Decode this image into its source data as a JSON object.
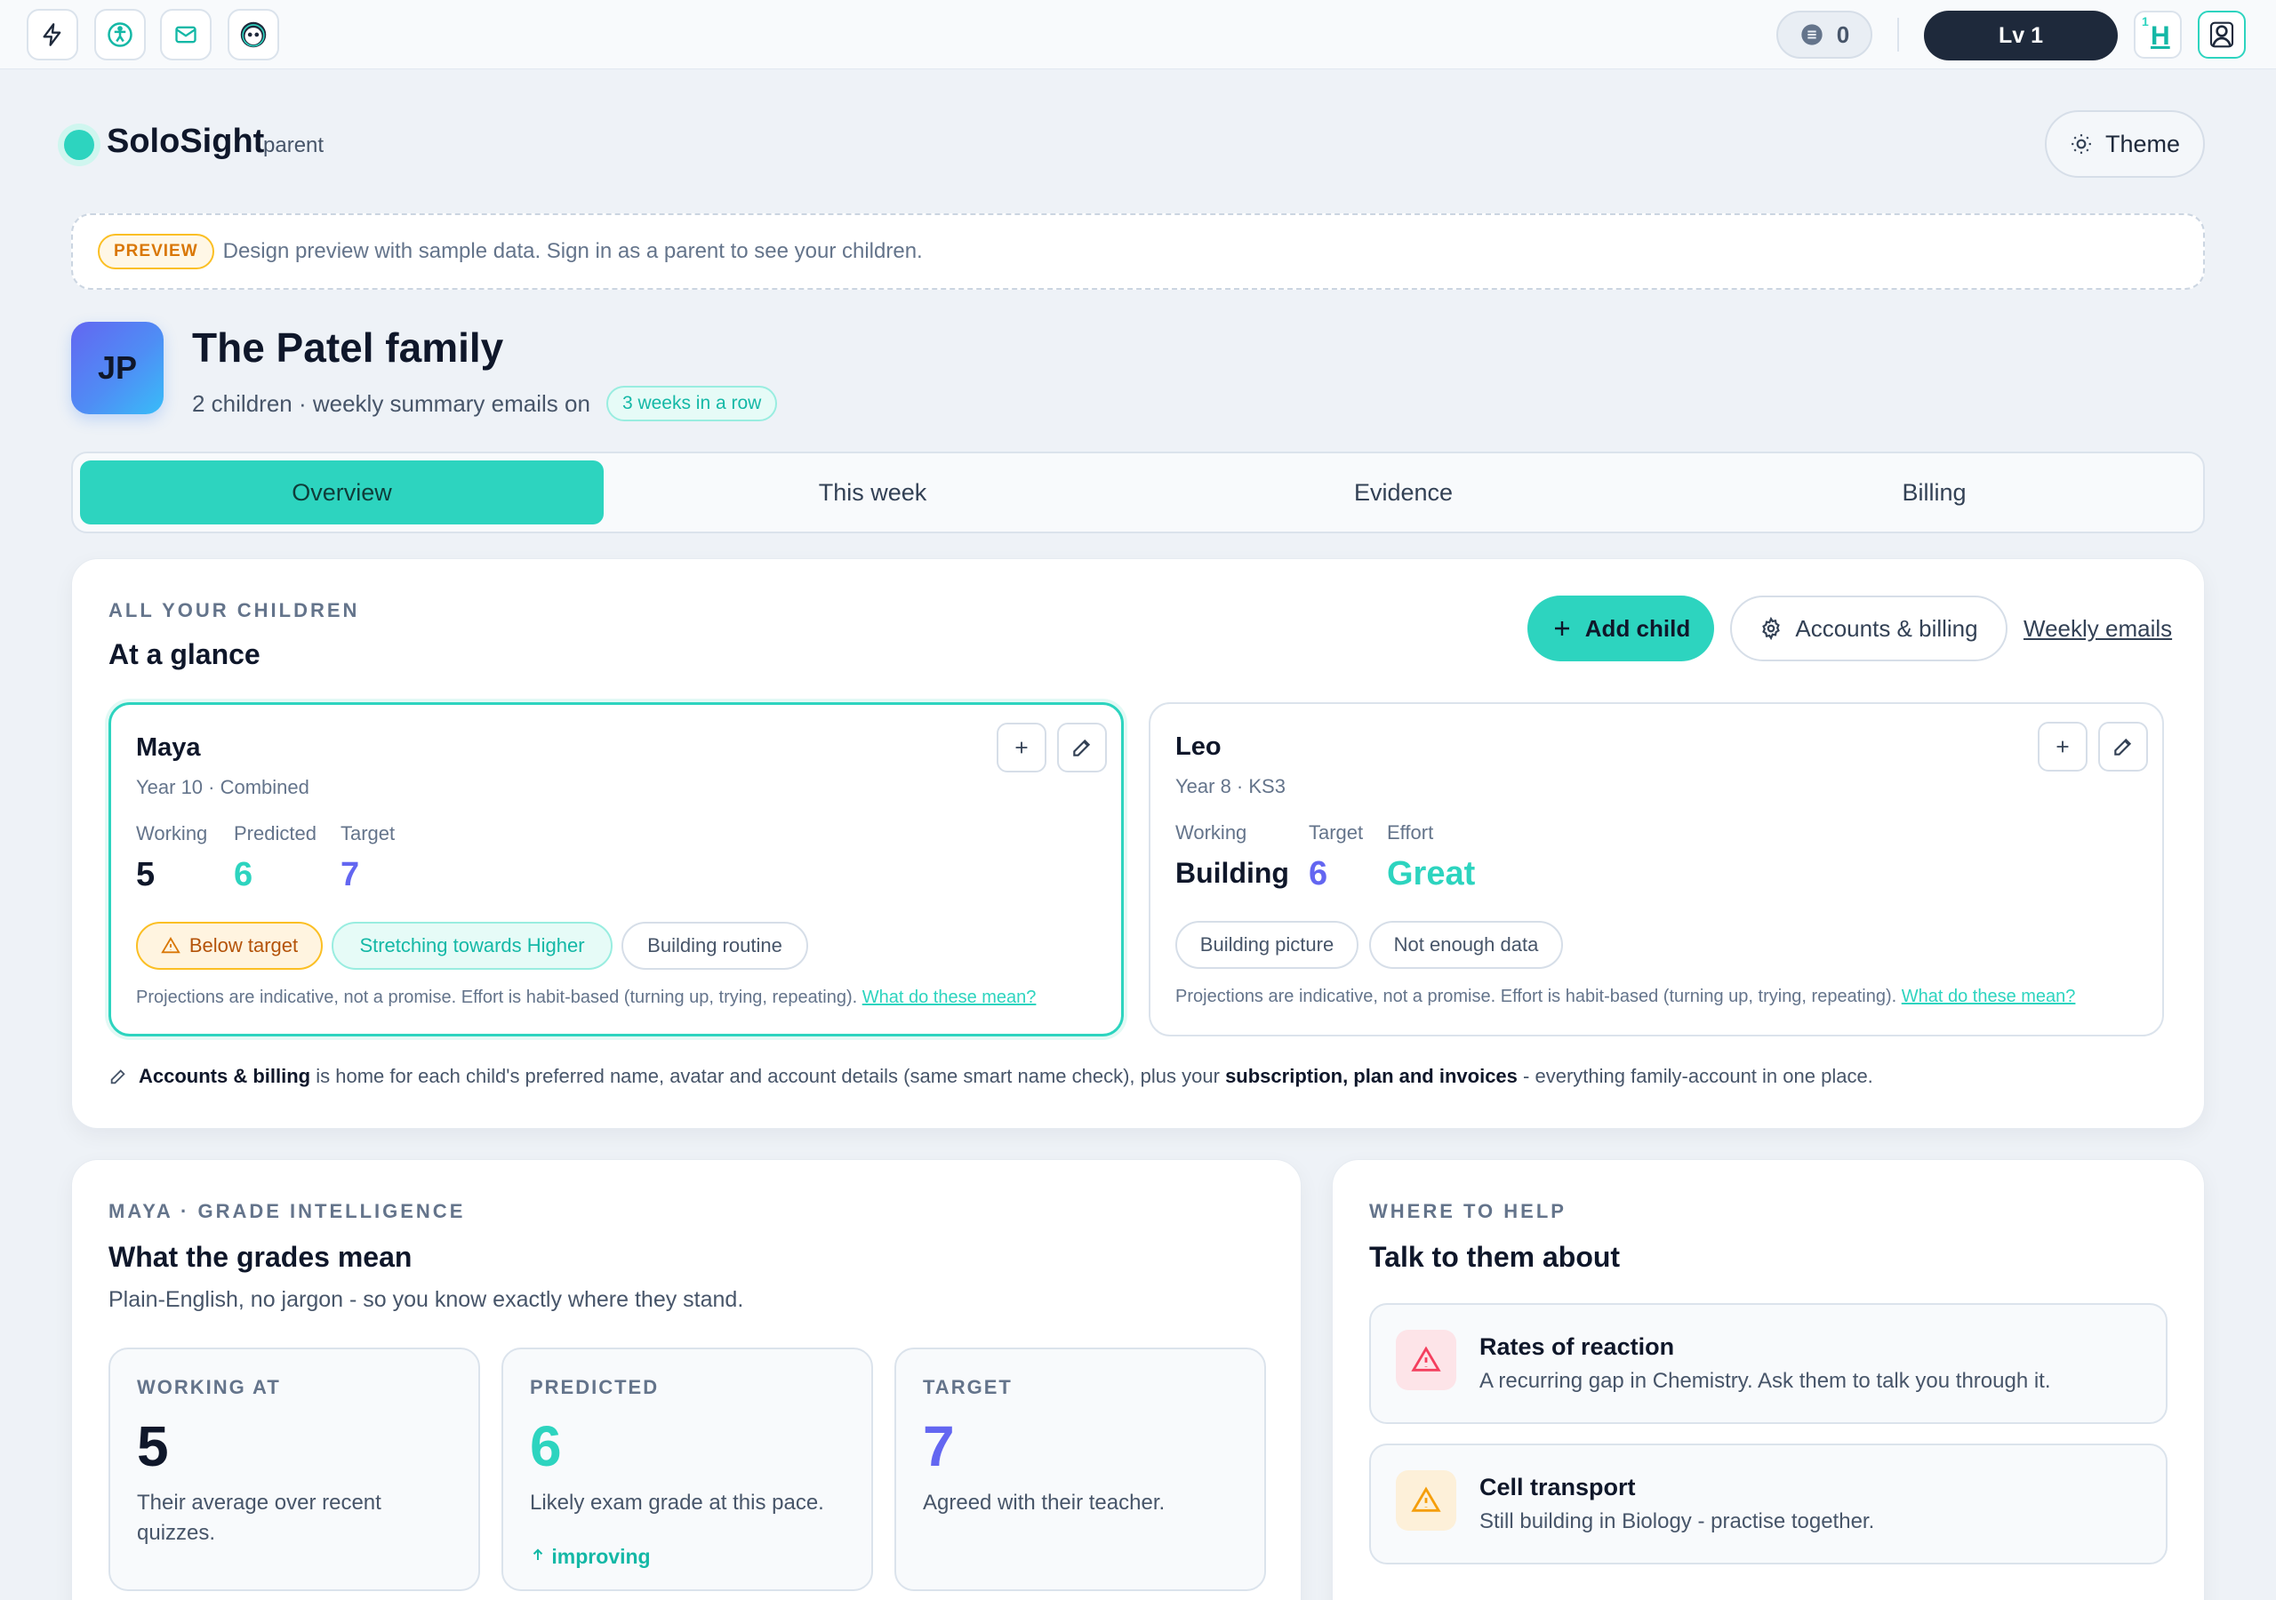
{
  "topbar": {
    "icons": [
      "lightning-icon",
      "accessibility-icon",
      "mail-icon",
      "mascot-icon"
    ],
    "coins": "0",
    "level": "Lv 1",
    "hint_sup": "1",
    "hint_letter": "H"
  },
  "brand": {
    "name": "SoloSight",
    "role": "parent",
    "theme_label": "Theme"
  },
  "preview": {
    "tag": "PREVIEW",
    "text": "Design preview with sample data. Sign in as a parent to see your children."
  },
  "family": {
    "initials": "JP",
    "name": "The Patel family",
    "subtitle": "2 children · weekly summary emails on",
    "streak": "3 weeks in a row"
  },
  "tabs": [
    "Overview",
    "This week",
    "Evidence",
    "Billing"
  ],
  "glance": {
    "eyebrow": "ALL YOUR CHILDREN",
    "title": "At a glance",
    "add_child": "Add child",
    "accounts": "Accounts & billing",
    "weekly": "Weekly emails"
  },
  "children": [
    {
      "name": "Maya",
      "meta": "Year 10 · Combined",
      "stats": [
        {
          "label": "Working",
          "value": "5"
        },
        {
          "label": "Predicted",
          "value": "6"
        },
        {
          "label": "Target",
          "value": "7"
        }
      ],
      "chips": [
        "Below target",
        "Stretching towards Higher",
        "Building routine"
      ],
      "disclaimer": "Projections are indicative, not a promise. Effort is habit-based (turning up, trying, repeating).",
      "link": "What do these mean?"
    },
    {
      "name": "Leo",
      "meta": "Year 8 · KS3",
      "stats": [
        {
          "label": "Working",
          "value": "Building"
        },
        {
          "label": "Target",
          "value": "6"
        },
        {
          "label": "Effort",
          "value": "Great"
        }
      ],
      "chips": [
        "Building picture",
        "Not enough data"
      ],
      "disclaimer": "Projections are indicative, not a promise. Effort is habit-based (turning up, trying, repeating).",
      "link": "What do these mean?"
    }
  ],
  "footnote": {
    "b1": "Accounts & billing",
    "t1": "is home for each child's preferred name, avatar and account details (same smart name check), plus your",
    "b2": "subscription, plan and invoices",
    "t2": "- everything family-account in one place."
  },
  "grades": {
    "eyebrow": "MAYA · GRADE INTELLIGENCE",
    "title": "What the grades mean",
    "subtitle": "Plain-English, no jargon - so you know exactly where they stand.",
    "cards": [
      {
        "label": "WORKING AT",
        "value": "5",
        "desc": "Their average over recent quizzes."
      },
      {
        "label": "PREDICTED",
        "value": "6",
        "desc": "Likely exam grade at this pace.",
        "trend": "improving"
      },
      {
        "label": "TARGET",
        "value": "7",
        "desc": "Agreed with their teacher."
      }
    ]
  },
  "help": {
    "eyebrow": "WHERE TO HELP",
    "title": "Talk to them about",
    "items": [
      {
        "title": "Rates of reaction",
        "desc": "A recurring gap in Chemistry. Ask them to talk you through it."
      },
      {
        "title": "Cell transport",
        "desc": "Still building in Biology - practise together."
      }
    ]
  },
  "colors": {
    "accent": "#2dd4bf",
    "predicted": "#2dd4bf",
    "target": "#6366f1",
    "warning": "#f59e0b",
    "danger": "#f43f5e",
    "dark": "#1e293b"
  }
}
